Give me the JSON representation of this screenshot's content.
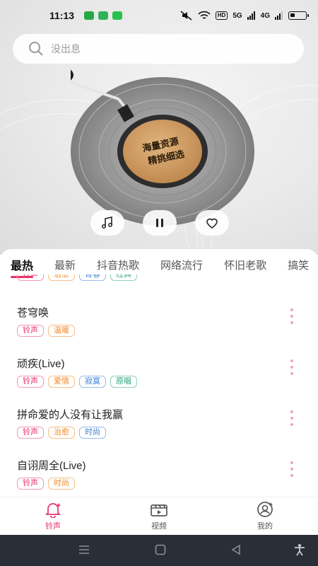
{
  "status_bar": {
    "time": "11:13",
    "hd_label": "HD",
    "signal_1": "5G",
    "signal_2": "4G"
  },
  "search": {
    "placeholder": "没出息"
  },
  "record": {
    "label_line1": "海量资源",
    "label_line2": "精挑细选"
  },
  "tabs": [
    {
      "label": "最热"
    },
    {
      "label": "最新"
    },
    {
      "label": "抖音热歌"
    },
    {
      "label": "网络流行"
    },
    {
      "label": "怀旧老歌"
    },
    {
      "label": "搞笑"
    }
  ],
  "partial_item": {
    "tags": [
      "铃声",
      "治愈",
      "青春",
      "经典"
    ]
  },
  "songs": [
    {
      "title": "苍穹唤",
      "tags": [
        "铃声",
        "温暖"
      ]
    },
    {
      "title": "顽疾(Live)",
      "tags": [
        "铃声",
        "爱情",
        "寂寞",
        "原唱"
      ]
    },
    {
      "title": "拼命爱的人没有让我赢",
      "tags": [
        "铃声",
        "治愈",
        "时尚"
      ]
    },
    {
      "title": "自诩周全(Live)",
      "tags": [
        "铃声",
        "时尚"
      ]
    }
  ],
  "bottom_nav": [
    {
      "label": "铃声",
      "icon": "bell-icon",
      "active": true
    },
    {
      "label": "视频",
      "icon": "video-icon",
      "active": false
    },
    {
      "label": "我的",
      "icon": "profile-icon",
      "active": false
    }
  ],
  "colors": {
    "accent": "#e8336a",
    "tag_pink": "#e8336a",
    "tag_orange": "#f08a2a",
    "tag_blue": "#3e7fd8",
    "tag_green": "#25a47a",
    "system_nav": "#2a2e37"
  }
}
